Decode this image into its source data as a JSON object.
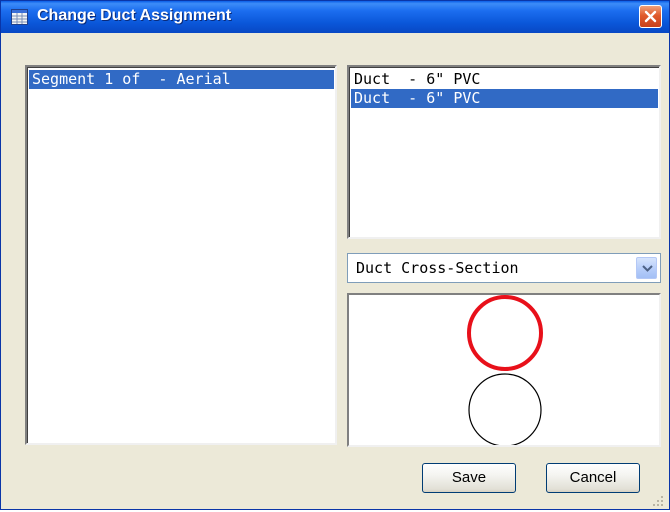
{
  "window": {
    "title": "Change Duct Assignment"
  },
  "segments": {
    "items": [
      {
        "label": "Segment 1 of  - Aerial",
        "selected": true
      }
    ]
  },
  "ducts": {
    "items": [
      {
        "label": "Duct  - 6\" PVC",
        "selected": false
      },
      {
        "label": "Duct  - 6\" PVC",
        "selected": true
      }
    ]
  },
  "view_select": {
    "value": "Duct Cross-Section"
  },
  "cross_section": {
    "ducts": [
      {
        "highlighted": true,
        "stroke": "#e8101a"
      },
      {
        "highlighted": false,
        "stroke": "#000000"
      }
    ]
  },
  "buttons": {
    "save_label": "Save",
    "cancel_label": "Cancel"
  },
  "colors": {
    "title_bar": "#0a56d8",
    "selection": "#316ac5",
    "highlight_duct": "#e8101a",
    "close_button": "#e05a2c"
  },
  "icons": {
    "app": "grid-window-icon",
    "close": "close-icon",
    "dropdown": "chevron-down-icon",
    "resize": "resize-grip-icon"
  }
}
